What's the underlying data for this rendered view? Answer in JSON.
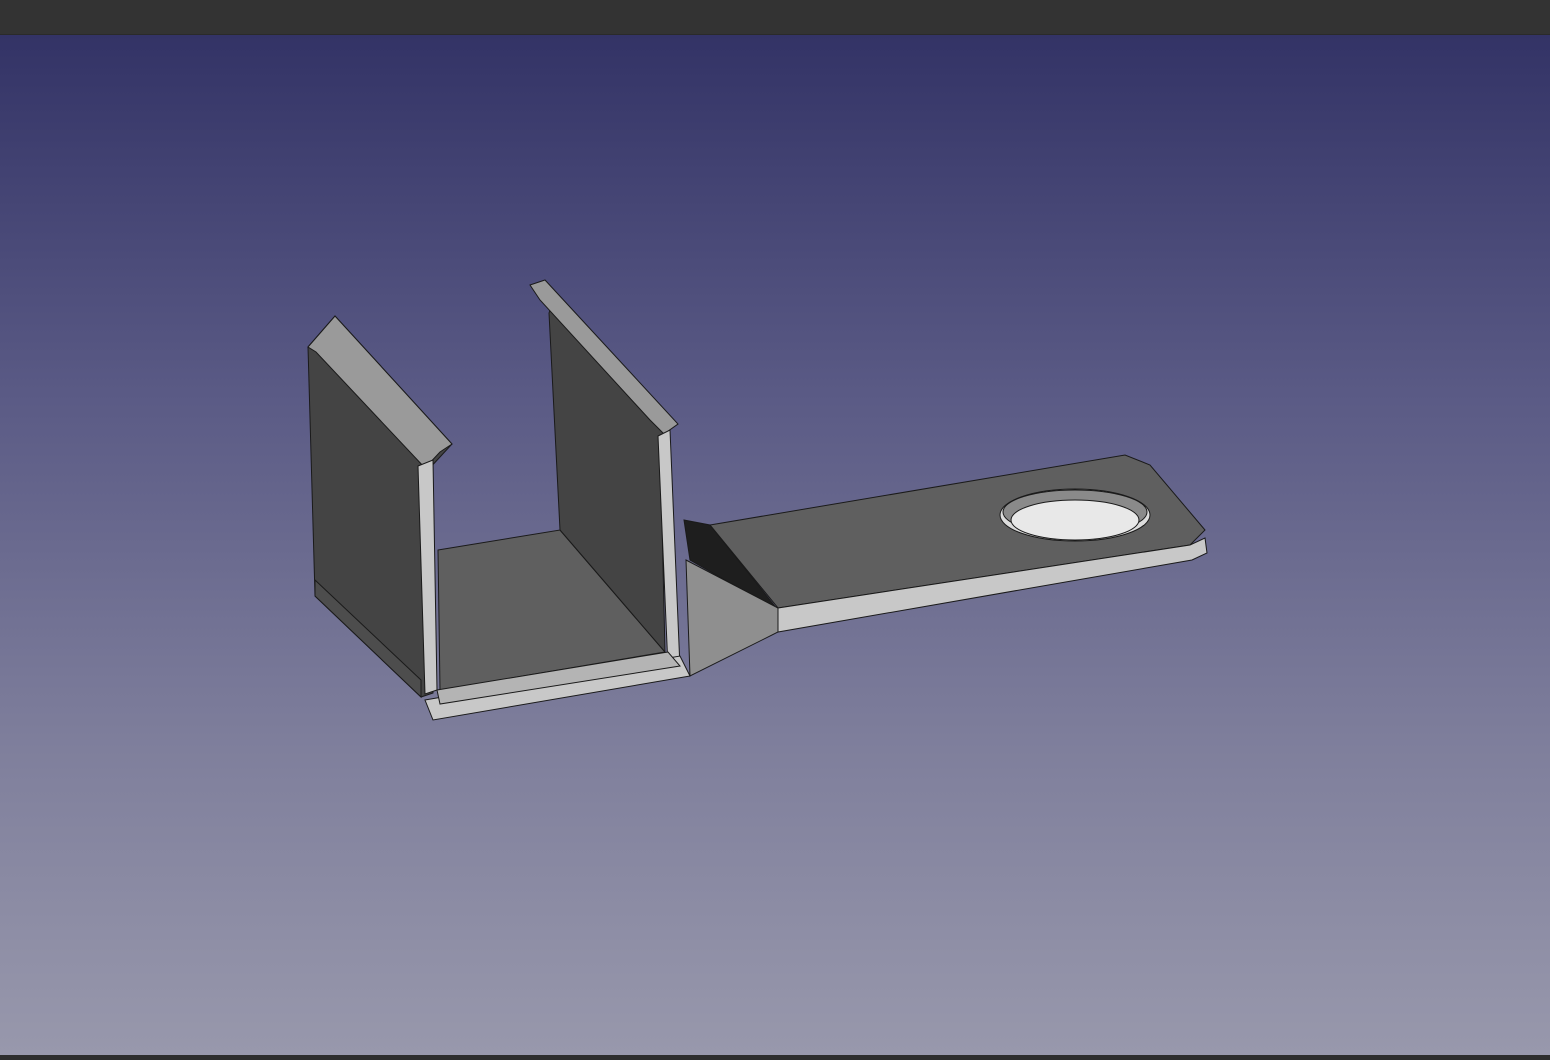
{
  "window": {
    "top_bar_color": "#333333"
  },
  "viewport": {
    "background_top": "#333366",
    "background_bottom": "#9898ac",
    "model": {
      "name": "bent-sheet-metal-bracket",
      "shade_colors": {
        "dark_face": "#444444",
        "mid_face": "#5f5f5f",
        "light_face": "#9a9a9a",
        "edge_face": "#c8c8c8",
        "edge_line": "#1a1a1a"
      },
      "icons": [
        "3d-part-icon",
        "hole-icon"
      ]
    }
  }
}
